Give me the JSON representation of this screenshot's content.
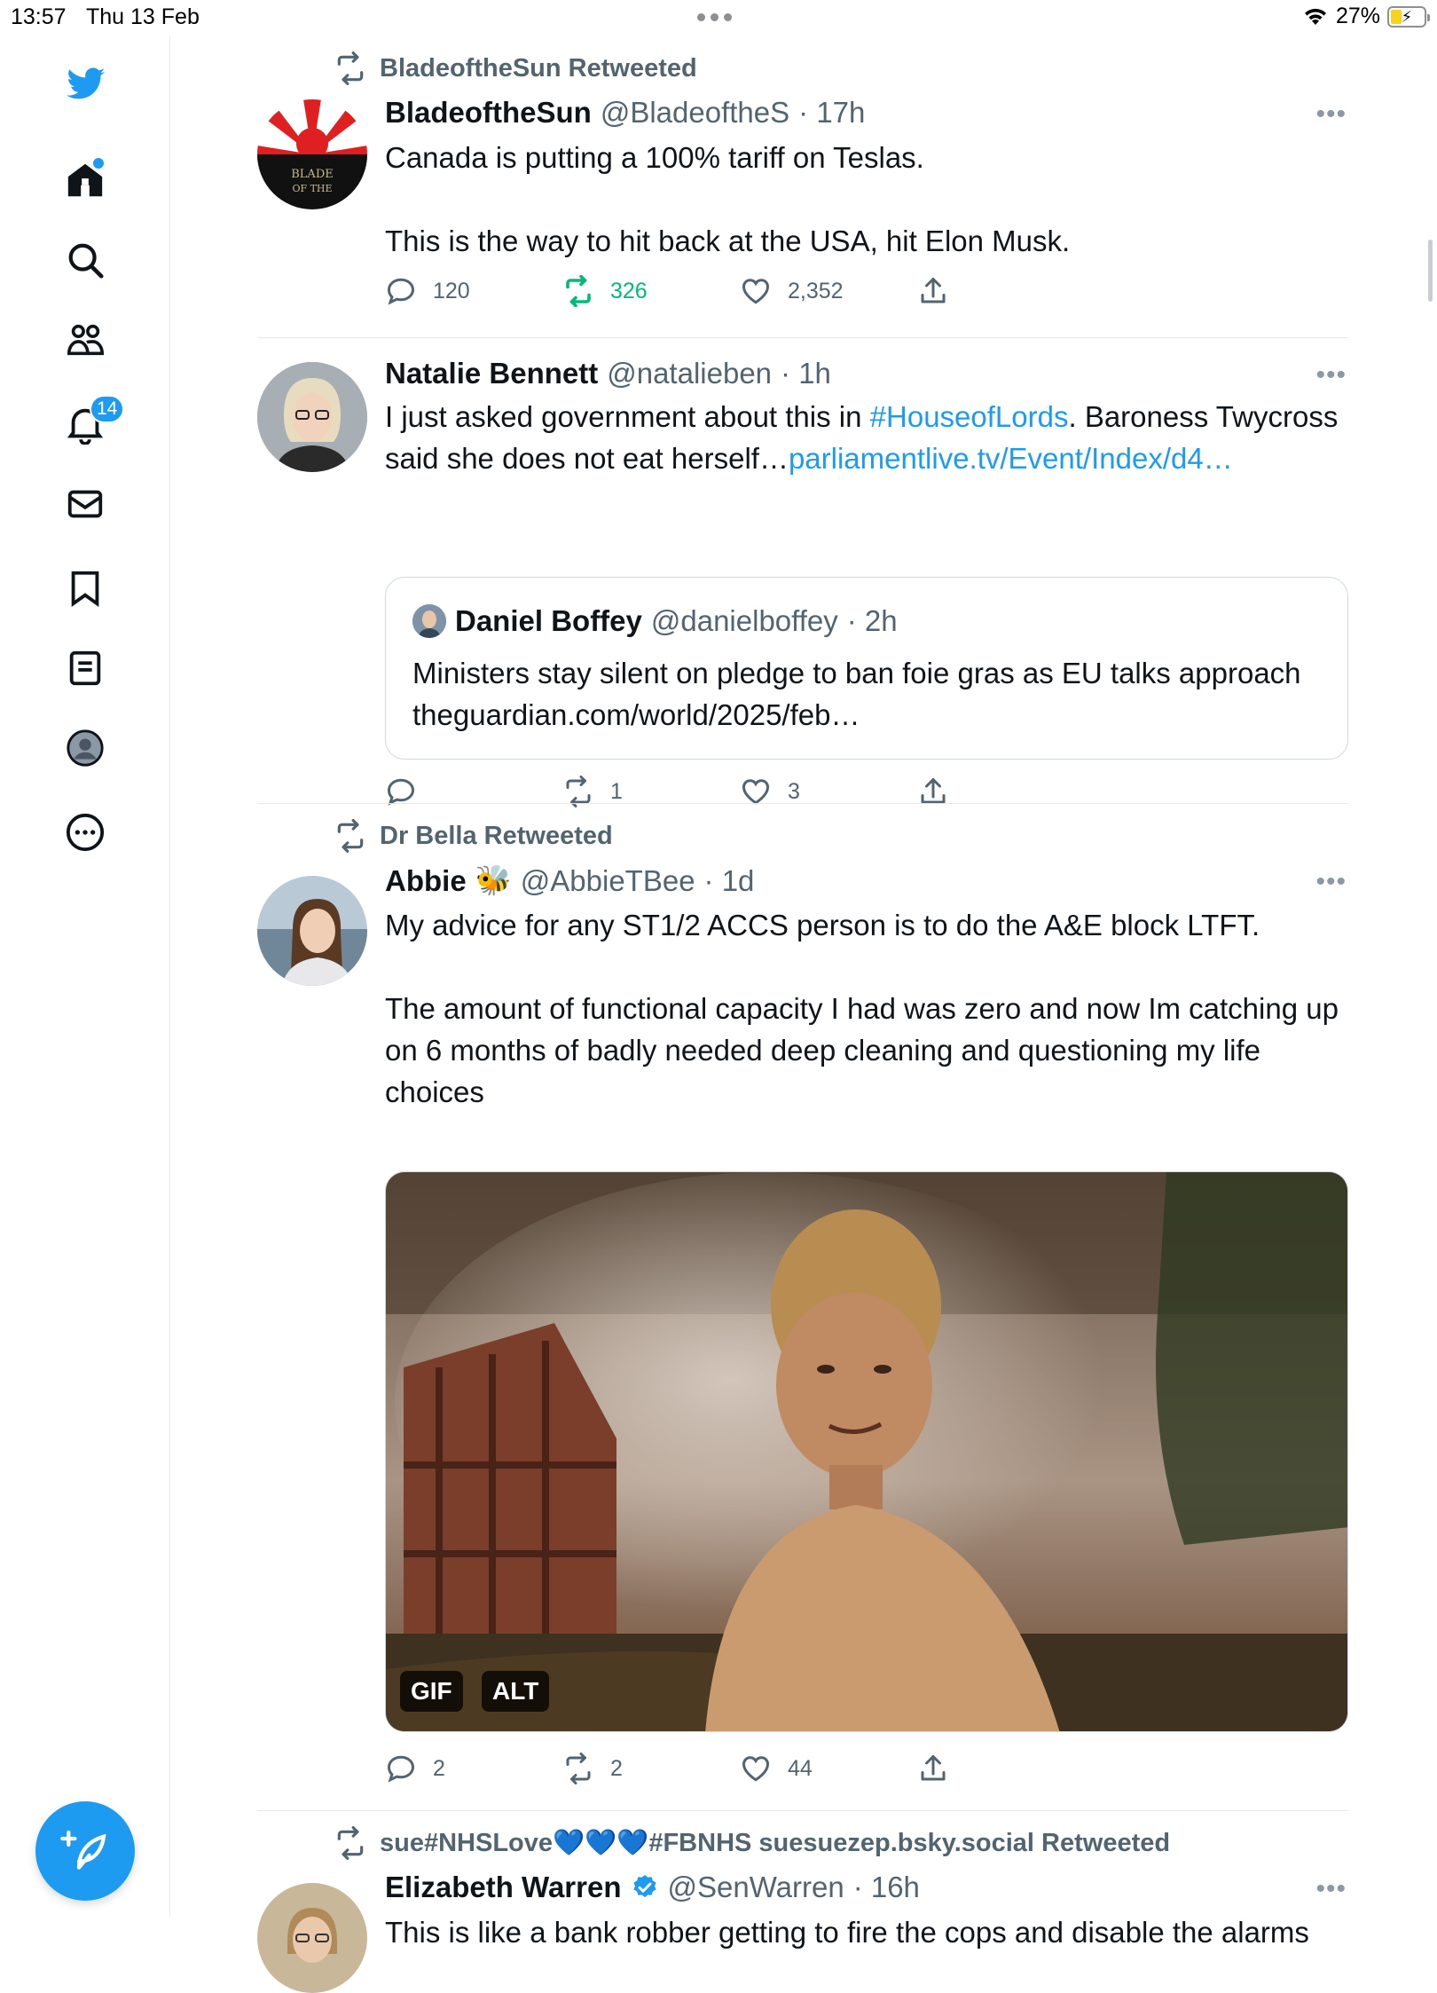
{
  "status_bar": {
    "time": "13:57",
    "date": "Thu 13 Feb",
    "battery": "27%"
  },
  "sidebar": {
    "notifications_badge": "14",
    "items": [
      {
        "icon": "twitter-bird-icon"
      },
      {
        "icon": "home-icon"
      },
      {
        "icon": "search-icon"
      },
      {
        "icon": "communities-icon"
      },
      {
        "icon": "bell-icon"
      },
      {
        "icon": "mail-icon"
      },
      {
        "icon": "bookmark-icon"
      },
      {
        "icon": "lists-icon"
      },
      {
        "icon": "profile-icon"
      },
      {
        "icon": "more-circle-icon"
      }
    ],
    "accent": "#1d9bf0"
  },
  "tweets": [
    {
      "retweeted_by": "BladeoftheSun Retweeted",
      "name": "BladeoftheSun",
      "handle": "@BladeoftheS",
      "time": "· 17h",
      "more": "•••",
      "text_1": "Canada is putting a 100% tariff on Teslas.",
      "text_2": "This is the way to hit back at the USA, hit Elon Musk.",
      "replies": "120",
      "retweets": "326",
      "likes": "2,352",
      "avatar_text": "BLADE OF THE"
    },
    {
      "name": "Natalie Bennett",
      "handle": "@natalieben",
      "time": "· 1h",
      "more": "•••",
      "text_a": "I just asked government about this in ",
      "hashtag": "#HouseofLords",
      "text_b": ". Baroness Twycross said she does not eat herself…",
      "link": "parliamentlive.tv/Event/Index/d4…",
      "quote": {
        "name": "Daniel Boffey",
        "handle": "@danielboffey",
        "time": "· 2h",
        "text": "Ministers stay silent on pledge to ban foie gras as EU talks approach theguardian.com/world/2025/feb…"
      },
      "replies": "",
      "retweets": "1",
      "likes": "3"
    },
    {
      "retweeted_by": "Dr Bella Retweeted",
      "name": "Abbie",
      "emoji": "🐝",
      "handle": "@AbbieTBee",
      "time": "· 1d",
      "more": "•••",
      "text_1": "My advice for any ST1/2 ACCS person is to do the A&E block LTFT.",
      "text_2": "The amount of functional capacity I had was zero and now Im catching up on 6 months of badly needed deep cleaning and questioning my life choices",
      "media_gif": "GIF",
      "media_alt": "ALT",
      "replies": "2",
      "retweets": "2",
      "likes": "44"
    },
    {
      "retweeted_by": "sue#NHSLove💙💙💙#FBNHS suesuezep.bsky.social Retweeted",
      "name": "Elizabeth Warren",
      "handle": "@SenWarren",
      "time": "· 16h",
      "more": "•••",
      "text_1": "This is like a bank robber getting to fire the cops and disable the alarms"
    }
  ]
}
